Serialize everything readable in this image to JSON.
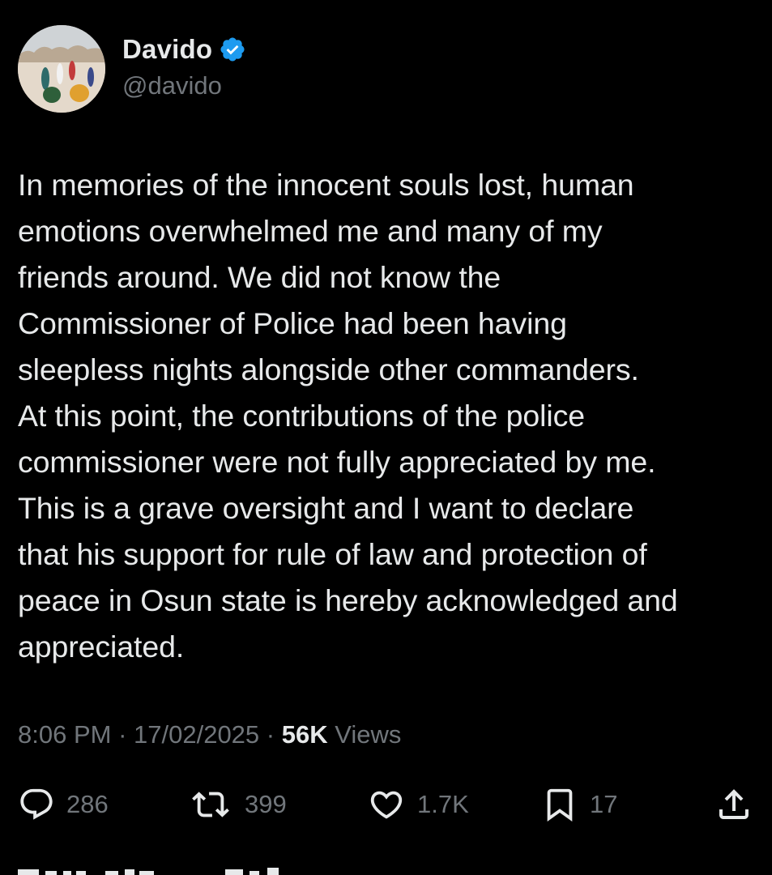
{
  "author": {
    "display_name": "Davido",
    "handle": "@davido",
    "verified": true
  },
  "tweet": {
    "text": "In memories of the innocent souls lost, human\nemotions overwhelmed me and many of my\nfriends around. We did not know the\nCommissioner of Police had been having\nsleepless nights alongside other commanders.\nAt this point, the contributions of the police\ncommissioner were not fully appreciated by me.\nThis is a grave oversight and I want to declare\nthat his support for rule of law and protection of\npeace in Osun state is hereby acknowledged and\nappreciated.",
    "time": "8:06 PM",
    "separator": " · ",
    "date": "17/02/2025",
    "views_count": "56K",
    "views_label": " Views"
  },
  "actions": {
    "replies": "286",
    "reposts": "399",
    "likes": "1.7K",
    "bookmarks": "17"
  },
  "colors": {
    "background": "#000000",
    "text_primary": "#e7e9ea",
    "text_secondary": "#71767b",
    "verified_badge": "#1d9bf0"
  },
  "icons": [
    "reply-icon",
    "repost-icon",
    "like-icon",
    "bookmark-icon",
    "share-icon",
    "verified-badge-icon"
  ]
}
